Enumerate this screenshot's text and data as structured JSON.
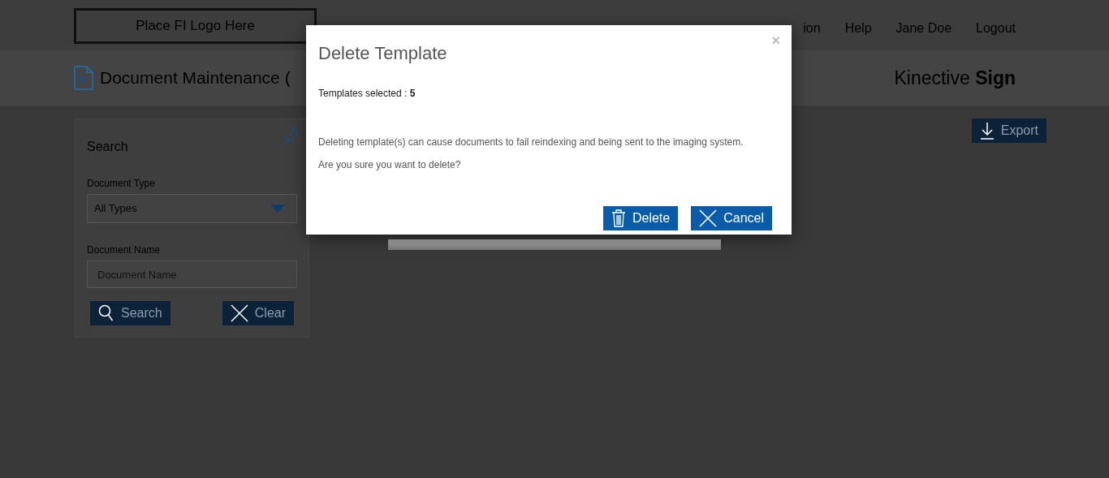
{
  "header": {
    "logo": "Place FI Logo Here",
    "nav": [
      {
        "label": "ion"
      },
      {
        "label": "Help"
      },
      {
        "label": "Jane Doe"
      },
      {
        "label": "Logout"
      }
    ]
  },
  "page": {
    "title": "Document Maintenance (",
    "brand": "Kinective **Sign**"
  },
  "search_panel": {
    "title": "Search",
    "fields": [
      {
        "kind": "select",
        "label": "Document Type",
        "value": "All Types"
      },
      {
        "kind": "text",
        "label": "Document Name",
        "placeholder": "Document Name"
      }
    ],
    "buttons": [
      {
        "kind": "search",
        "label": "Search"
      },
      {
        "kind": "clear",
        "label": "Clear"
      }
    ]
  },
  "toolbar": {
    "buttons": [
      {
        "kind": "export",
        "label": "Export"
      }
    ]
  },
  "dialog": {
    "title": "Delete Template",
    "close": "×",
    "summary": "Templates selected : **5**",
    "message": [
      "Deleting template(s) can cause documents to fail reindexing and being sent to the imaging system.",
      "Are you sure you want to delete?"
    ],
    "buttons": [
      {
        "kind": "delete",
        "label": "Delete"
      },
      {
        "kind": "cancel",
        "label": "Cancel"
      }
    ]
  }
}
